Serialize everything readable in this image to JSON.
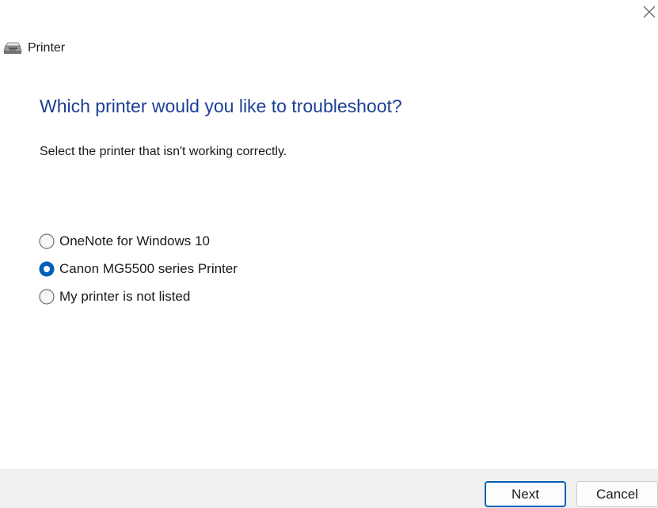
{
  "window": {
    "title": "Printer",
    "close_icon": "close-icon",
    "app_icon": "printer-icon"
  },
  "main": {
    "heading": "Which printer would you like to troubleshoot?",
    "instruction": "Select the printer that isn't working correctly.",
    "options": [
      {
        "label": "OneNote for Windows 10",
        "selected": false
      },
      {
        "label": "Canon MG5500 series Printer",
        "selected": true
      },
      {
        "label": "My printer is not listed",
        "selected": false
      }
    ]
  },
  "footer": {
    "next_label": "Next",
    "cancel_label": "Cancel"
  },
  "colors": {
    "heading": "#1c3f94",
    "accent": "#005fb8",
    "footer_bg": "#f0f0f0"
  }
}
